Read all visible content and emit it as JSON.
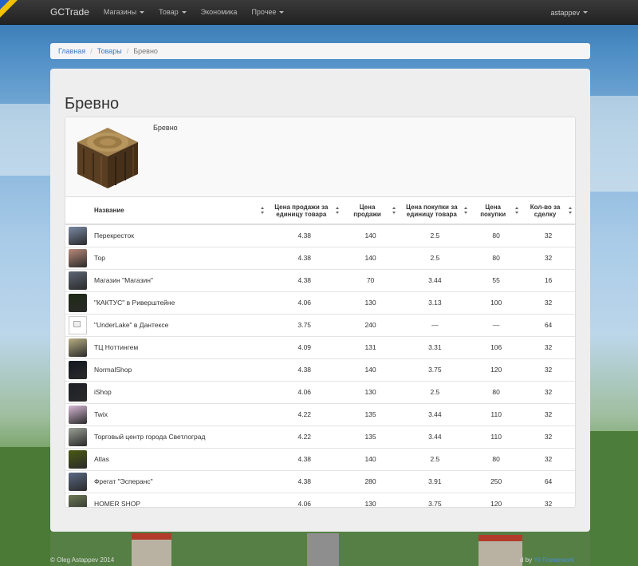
{
  "nav": {
    "brand": "GCTrade",
    "items": [
      {
        "label": "Магазины",
        "dropdown": true
      },
      {
        "label": "Товар",
        "dropdown": true
      },
      {
        "label": "Экономика",
        "dropdown": false
      },
      {
        "label": "Прочее",
        "dropdown": true
      }
    ],
    "user": "astappev",
    "user_dropdown": true
  },
  "breadcrumb": {
    "home": "Главная",
    "items": "Товары",
    "current": "Бревно"
  },
  "page": {
    "title": "Бревно",
    "product_name": "Бревно",
    "product_icon": "oak-log-block-icon"
  },
  "table": {
    "headers": [
      "Название",
      "Цена продажи за единицу товара",
      "Цена продажи",
      "Цена покупки за единицу товара",
      "Цена покупки",
      "Кол-во за сделку"
    ],
    "rows": [
      {
        "name": "Перекресток",
        "icon": "tower-thumb",
        "color": "#7a8aa4",
        "unit_sell": "4.38",
        "sell": "140",
        "unit_buy": "2.5",
        "buy": "80",
        "qty": "32"
      },
      {
        "name": "Тор",
        "icon": "bricks-thumb",
        "color": "#b98a7a",
        "unit_sell": "4.38",
        "sell": "140",
        "unit_buy": "2.5",
        "buy": "80",
        "qty": "32"
      },
      {
        "name": "Магазин \"Магазин\"",
        "icon": "tower-thumb",
        "color": "#5d6675",
        "unit_sell": "4.38",
        "sell": "70",
        "unit_buy": "3.44",
        "buy": "55",
        "qty": "16"
      },
      {
        "name": "\"КАКТУС\" в Риверштейне",
        "icon": "cactus-thumb",
        "color": "#1e2a14",
        "unit_sell": "4.06",
        "sell": "130",
        "unit_buy": "3.13",
        "buy": "100",
        "qty": "32"
      },
      {
        "name": "\"UnderLake\" в Дантексе",
        "icon": "broken-image-icon",
        "color": "#ffffff",
        "unit_sell": "3.75",
        "sell": "240",
        "unit_buy": "—",
        "buy": "—",
        "qty": "64"
      },
      {
        "name": "ТЦ Ноттингем",
        "icon": "tree-thumb",
        "color": "#b7ae84",
        "unit_sell": "4.09",
        "sell": "131",
        "unit_buy": "3.31",
        "buy": "106",
        "qty": "32"
      },
      {
        "name": "NormalShop",
        "icon": "dark-thumb",
        "color": "#121822",
        "unit_sell": "4.38",
        "sell": "140",
        "unit_buy": "3.75",
        "buy": "120",
        "qty": "32"
      },
      {
        "name": "iShop",
        "icon": "dark-thumb",
        "color": "#1c2026",
        "unit_sell": "4.06",
        "sell": "130",
        "unit_buy": "2.5",
        "buy": "80",
        "qty": "32"
      },
      {
        "name": "Twix",
        "icon": "striped-thumb",
        "color": "#d7b9d6",
        "unit_sell": "4.22",
        "sell": "135",
        "unit_buy": "3.44",
        "buy": "110",
        "qty": "32"
      },
      {
        "name": "Торговый центр города Светлоград",
        "icon": "building-thumb",
        "color": "#9aa096",
        "unit_sell": "4.22",
        "sell": "135",
        "unit_buy": "3.44",
        "buy": "110",
        "qty": "32"
      },
      {
        "name": "Atlas",
        "icon": "atlas-logo-thumb",
        "color": "#4a5a12",
        "unit_sell": "4.38",
        "sell": "140",
        "unit_buy": "2.5",
        "buy": "80",
        "qty": "32"
      },
      {
        "name": "Фрегат \"Эсперанс\"",
        "icon": "ship-thumb",
        "color": "#5b6a86",
        "unit_sell": "4.38",
        "sell": "280",
        "unit_buy": "3.91",
        "buy": "250",
        "qty": "64"
      },
      {
        "name": "HOMER SHOP",
        "icon": "homer-thumb",
        "color": "#6c7a55",
        "unit_sell": "4.06",
        "sell": "130",
        "unit_buy": "3.75",
        "buy": "120",
        "qty": "32"
      }
    ]
  },
  "footer": {
    "left": "© Oleg Astappev 2014",
    "right_prefix": "d by",
    "right_link": "Yii Framework"
  }
}
